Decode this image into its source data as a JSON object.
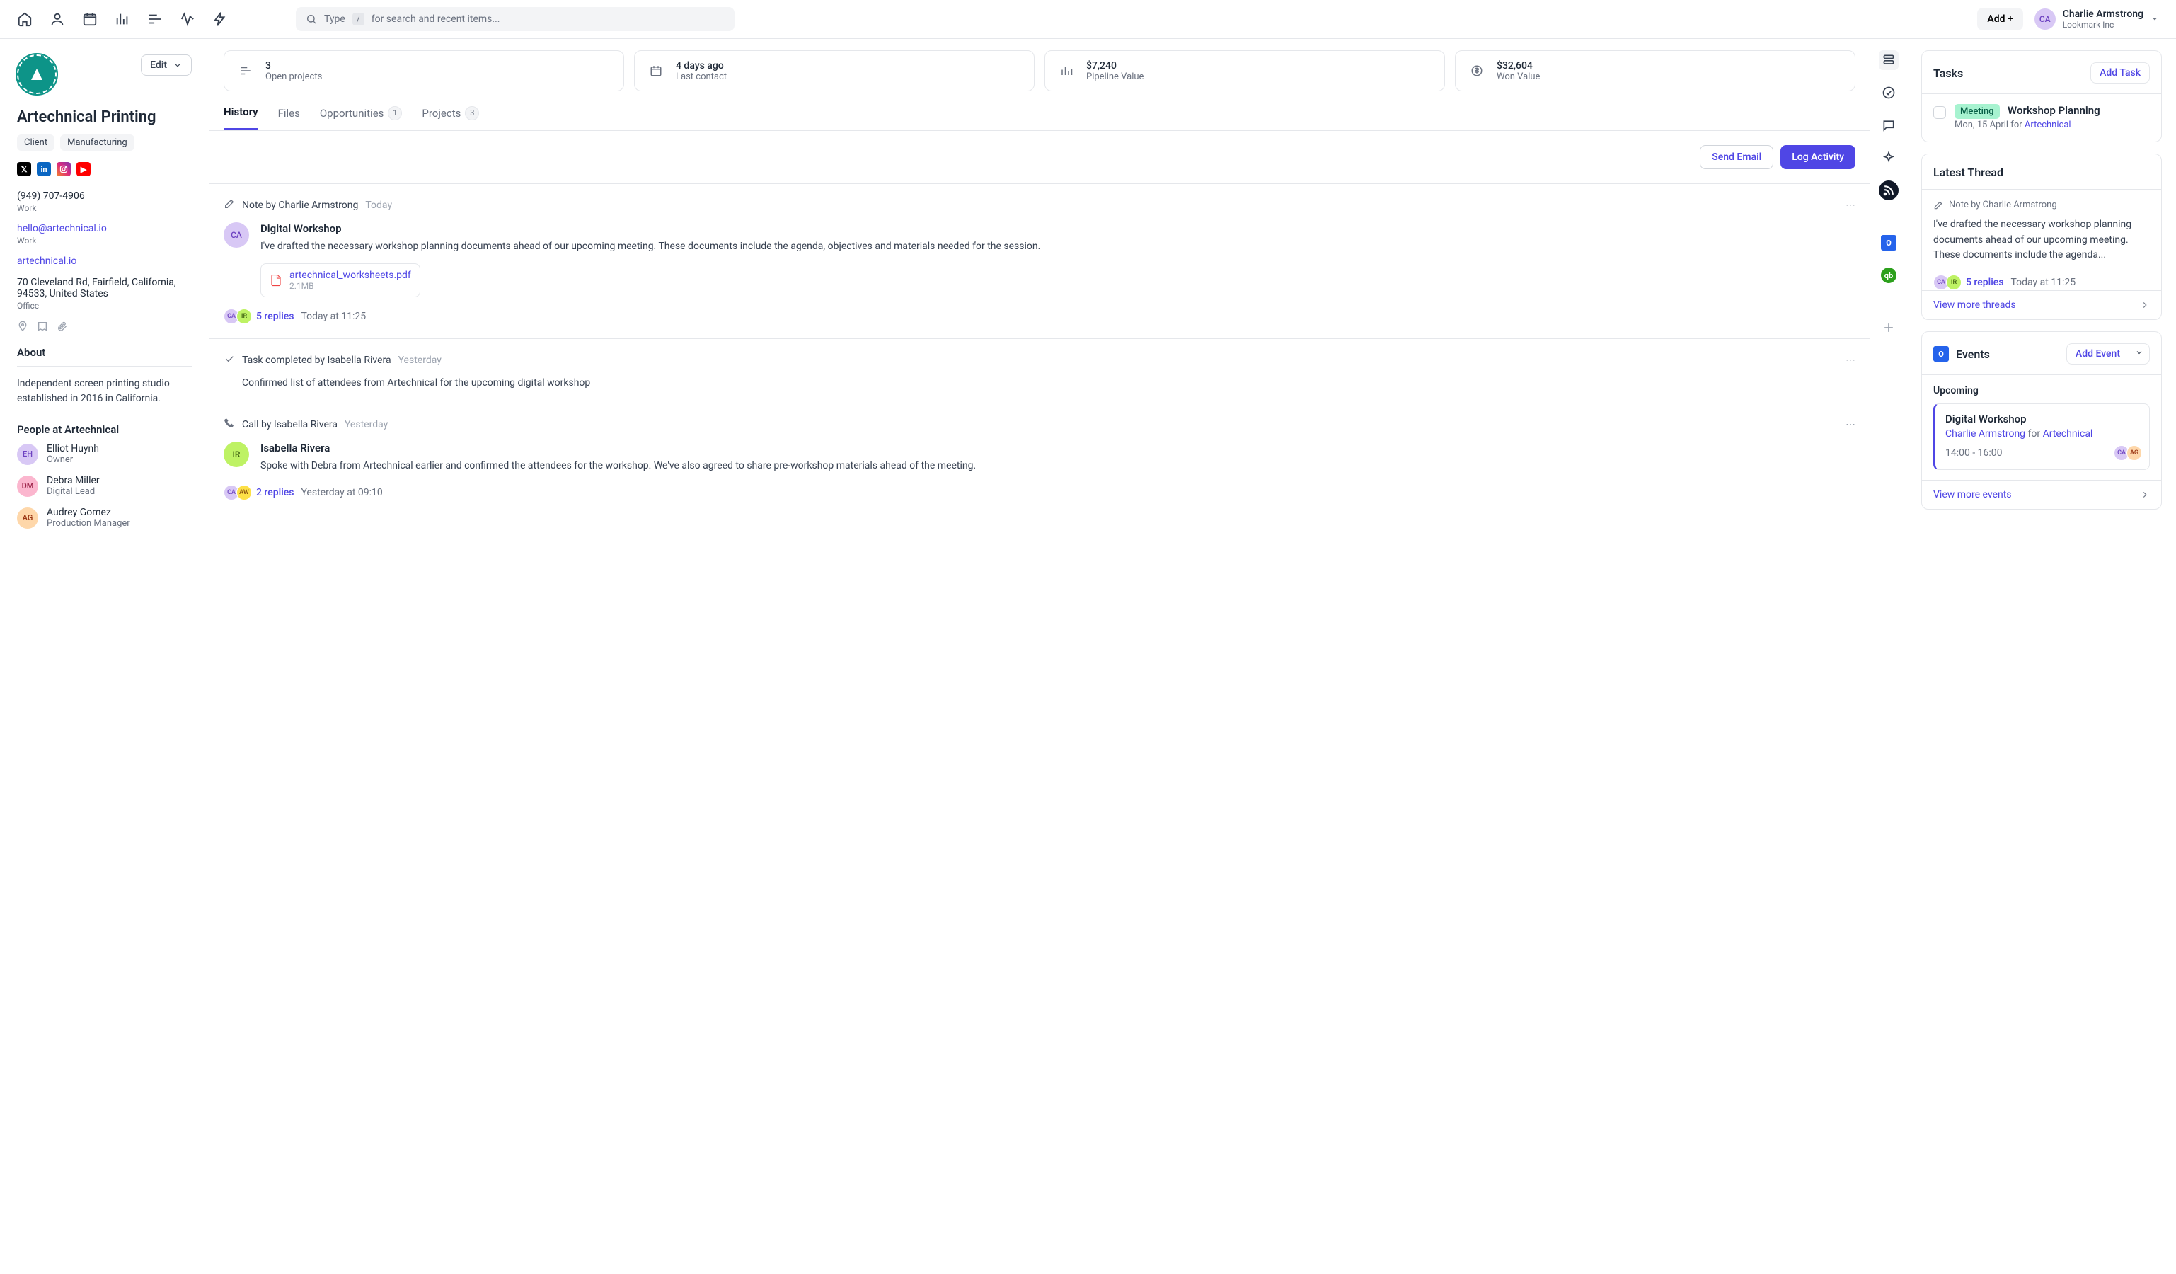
{
  "topbar": {
    "search_prefix": "Type",
    "search_key": "/",
    "search_hint": "for search and recent items...",
    "add_label": "Add +",
    "user": {
      "initials": "CA",
      "name": "Charlie Armstrong",
      "org": "Lookmark Inc"
    }
  },
  "company": {
    "name": "Artechnical Printing",
    "edit_label": "Edit",
    "tags": [
      "Client",
      "Manufacturing"
    ],
    "phone": "(949) 707-4906",
    "phone_label": "Work",
    "email": "hello@artechnical.io",
    "email_label": "Work",
    "website": "artechnical.io",
    "address": "70 Cleveland Rd, Fairfield, California, 94533, United States",
    "address_label": "Office",
    "about_title": "About",
    "about_text": "Independent screen printing studio established in 2016 in California.",
    "people_title": "People at Artechnical",
    "people": [
      {
        "initials": "EH",
        "name": "Elliot Huynh",
        "role": "Owner",
        "bg": "#d8c8f5",
        "fg": "#6d42c1"
      },
      {
        "initials": "DM",
        "name": "Debra Miller",
        "role": "Digital Lead",
        "bg": "#fbb6ce",
        "fg": "#9d2449"
      },
      {
        "initials": "AG",
        "name": "Audrey Gomez",
        "role": "Production Manager",
        "bg": "#fed7aa",
        "fg": "#9a3412"
      }
    ]
  },
  "summary": [
    {
      "value": "3",
      "label": "Open projects"
    },
    {
      "value": "4 days ago",
      "label": "Last contact"
    },
    {
      "value": "$7,240",
      "label": "Pipeline Value"
    },
    {
      "value": "$32,604",
      "label": "Won Value"
    }
  ],
  "tabs": [
    {
      "label": "History",
      "badge": null,
      "active": true
    },
    {
      "label": "Files",
      "badge": null,
      "active": false
    },
    {
      "label": "Opportunities",
      "badge": "1",
      "active": false
    },
    {
      "label": "Projects",
      "badge": "3",
      "active": false
    }
  ],
  "actions": {
    "send_email": "Send Email",
    "log_activity": "Log Activity"
  },
  "timeline": [
    {
      "type": "note",
      "header": "Note by Charlie Armstrong",
      "when": "Today",
      "avatar": {
        "initials": "CA",
        "bg": "#d8c8f5",
        "fg": "#6d42c1"
      },
      "title": "Digital Workshop",
      "body": "I've drafted the necessary workshop planning documents ahead of our upcoming meeting. These documents include the agenda, objectives and materials needed for the session.",
      "attachment": {
        "name": "artechnical_worksheets.pdf",
        "size": "2.1MB"
      },
      "replies": {
        "avatars": [
          {
            "i": "CA",
            "bg": "#d8c8f5",
            "fg": "#6d42c1"
          },
          {
            "i": "IR",
            "bg": "#bef264",
            "fg": "#3f6212"
          }
        ],
        "count": "5 replies",
        "time": "Today at 11:25"
      }
    },
    {
      "type": "task",
      "header": "Task completed by Isabella Rivera",
      "when": "Yesterday",
      "body": "Confirmed list of attendees from Artechnical for the upcoming digital workshop"
    },
    {
      "type": "call",
      "header": "Call by Isabella Rivera",
      "when": "Yesterday",
      "avatar": {
        "initials": "IR",
        "bg": "#bef264",
        "fg": "#3f6212"
      },
      "title": "Isabella Rivera",
      "body": "Spoke with Debra from Artechnical earlier and confirmed the attendees for the workshop. We've also agreed to share pre-workshop materials ahead of the meeting.",
      "replies": {
        "avatars": [
          {
            "i": "CA",
            "bg": "#d8c8f5",
            "fg": "#6d42c1"
          },
          {
            "i": "AW",
            "bg": "#fde047",
            "fg": "#854d0e"
          }
        ],
        "count": "2 replies",
        "time": "Yesterday at 09:10"
      }
    }
  ],
  "tasks": {
    "title": "Tasks",
    "add_label": "Add Task",
    "item": {
      "badge": "Meeting",
      "title": "Workshop Planning",
      "sub_prefix": "Mon, 15 April for ",
      "sub_link": "Artechnical"
    }
  },
  "thread": {
    "title": "Latest Thread",
    "note_label": "Note by Charlie Armstrong",
    "text": "I've drafted the necessary workshop planning documents ahead of our upcoming meeting. These documents include the agenda...",
    "replies_count": "5 replies",
    "replies_time": "Today at 11:25",
    "avatars": [
      {
        "i": "CA",
        "bg": "#d8c8f5",
        "fg": "#6d42c1"
      },
      {
        "i": "IR",
        "bg": "#bef264",
        "fg": "#3f6212"
      }
    ],
    "more": "View more threads"
  },
  "events": {
    "title": "Events",
    "add_label": "Add Event",
    "upcoming": "Upcoming",
    "item": {
      "name": "Digital Workshop",
      "by": "Charlie Armstrong",
      "for_word": " for ",
      "for_company": "Artechnical",
      "time": "14:00 - 16:00",
      "avatars": [
        {
          "i": "CA",
          "bg": "#d8c8f5",
          "fg": "#6d42c1"
        },
        {
          "i": "AG",
          "bg": "#fed7aa",
          "fg": "#9a3412"
        }
      ]
    },
    "more": "View more events"
  }
}
